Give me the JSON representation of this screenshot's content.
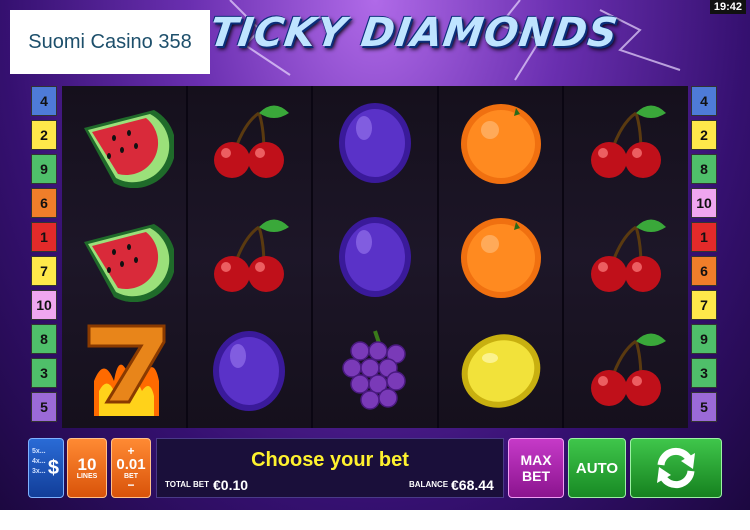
{
  "header": {
    "clock": "19:42",
    "title": "TICKY DIAMONDS",
    "brand": "Suomi Casino 358"
  },
  "paylines": {
    "left": [
      {
        "n": "4",
        "c": "#4e7bd8"
      },
      {
        "n": "2",
        "c": "#ffe84a"
      },
      {
        "n": "9",
        "c": "#4fbf6a"
      },
      {
        "n": "6",
        "c": "#f07e2a"
      },
      {
        "n": "1",
        "c": "#e32a2a"
      },
      {
        "n": "7",
        "c": "#ffe84a"
      },
      {
        "n": "10",
        "c": "#f0a6f0"
      },
      {
        "n": "8",
        "c": "#4fbf6a"
      },
      {
        "n": "3",
        "c": "#4fbf6a"
      },
      {
        "n": "5",
        "c": "#9b6ad8"
      }
    ],
    "right": [
      {
        "n": "4",
        "c": "#4e7bd8"
      },
      {
        "n": "2",
        "c": "#ffe84a"
      },
      {
        "n": "8",
        "c": "#4fbf6a"
      },
      {
        "n": "10",
        "c": "#f0a6f0"
      },
      {
        "n": "1",
        "c": "#e32a2a"
      },
      {
        "n": "6",
        "c": "#f07e2a"
      },
      {
        "n": "7",
        "c": "#ffe84a"
      },
      {
        "n": "9",
        "c": "#4fbf6a"
      },
      {
        "n": "3",
        "c": "#4fbf6a"
      },
      {
        "n": "5",
        "c": "#9b6ad8"
      }
    ]
  },
  "reels": [
    [
      "watermelon-icon",
      "watermelon-icon",
      "seven-icon"
    ],
    [
      "cherry-icon",
      "cherry-icon",
      "plum-icon"
    ],
    [
      "plum-icon",
      "plum-icon",
      "grapes-icon"
    ],
    [
      "orange-icon",
      "orange-icon",
      "lemon-icon"
    ],
    [
      "cherry-icon",
      "cherry-icon",
      "cherry-icon"
    ]
  ],
  "controls": {
    "denom_lines": [
      "5x...",
      "4x...",
      "3x..."
    ],
    "denom_symbol": "$",
    "lines_value": "10",
    "lines_label": "LINES",
    "bet_plus": "+",
    "bet_value": "0.01",
    "bet_label": "BET",
    "bet_minus": "−",
    "message": "Choose your bet",
    "total_bet_label": "TOTAL BET",
    "total_bet_value": "€0.10",
    "balance_label": "BALANCE",
    "balance_value": "€68.44",
    "max_bet_line1": "MAX",
    "max_bet_line2": "BET",
    "auto_label": "AUTO"
  },
  "colors": {
    "accent_yellow": "#fff22e",
    "brand_text": "#1d4f6b"
  }
}
